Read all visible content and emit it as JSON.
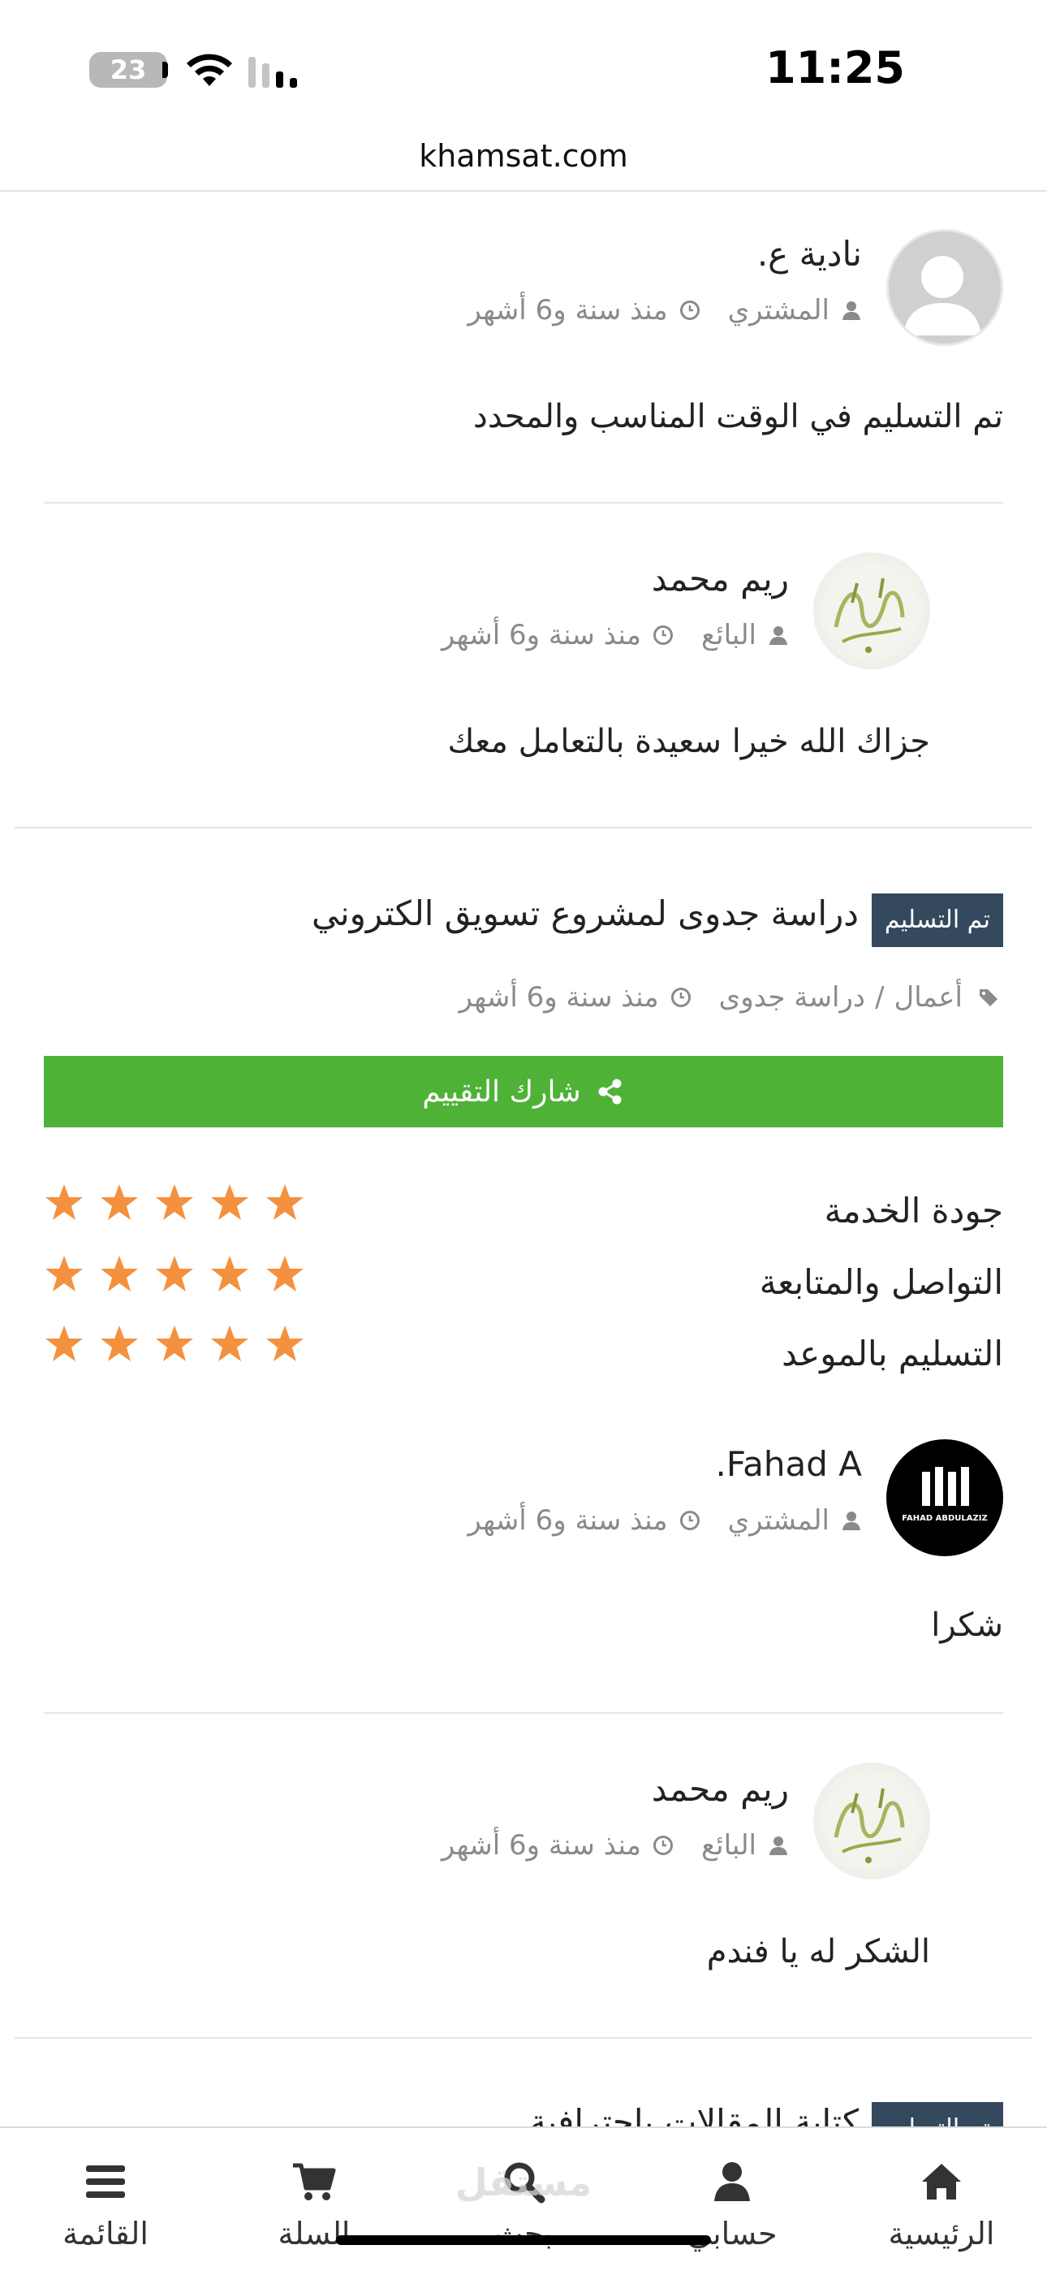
{
  "status_bar": {
    "time": "11:25",
    "battery_level": "23"
  },
  "browser": {
    "url": "khamsat.com"
  },
  "reviews_top": [
    {
      "name": "نادية ع.",
      "role": "المشتري",
      "time": "منذ سنة و6 أشهر",
      "text": "تم التسليم في الوقت المناسب والمحدد",
      "avatar": "default-user-icon"
    },
    {
      "name": "ريم محمد",
      "role": "البائع",
      "time": "منذ سنة و6 أشهر",
      "text": "جزاك الله خيرا سعيدة بالتعامل معك",
      "avatar": "calligraphy-avatar"
    }
  ],
  "service": {
    "badge": "تم التسليم",
    "title": "دراسة جدوى لمشروع تسويق الكتروني",
    "category_prefix": "أعمال",
    "category_separator": "/",
    "category": "دراسة جدوى",
    "time": "منذ سنة و6 أشهر",
    "share_label": "شارك التقييم",
    "ratings": [
      {
        "label": "جودة الخدمة",
        "stars": 5
      },
      {
        "label": "التواصل والمتابعة",
        "stars": 5
      },
      {
        "label": "التسليم بالموعد",
        "stars": 5
      }
    ],
    "star_color": "#f4913e",
    "share_color": "#4eb237",
    "badge_color": "#34495e"
  },
  "reviews_bottom": [
    {
      "name": "Fahad A.",
      "role": "المشتري",
      "time": "منذ سنة و6 أشهر",
      "text": "شكرا",
      "avatar": "fahad-abdulaziz-logo"
    },
    {
      "name": "ريم محمد",
      "role": "البائع",
      "time": "منذ سنة و6 أشهر",
      "text": "الشكر له يا فندم",
      "avatar": "calligraphy-avatar"
    }
  ],
  "next_service": {
    "badge": "تم التسليم",
    "title": "كتابة المقالات باحترافية"
  },
  "logo_text": {
    "fahad": "FAHAD ABDULAZIZ",
    "calligraphy": "اللهم صل على سيدنا محمد",
    "watermark": "مستقل"
  },
  "bottom_nav": [
    {
      "label": "الرئيسية",
      "icon": "home-icon"
    },
    {
      "label": "حسابي",
      "icon": "user-icon"
    },
    {
      "label": "بحث",
      "icon": "search-icon"
    },
    {
      "label": "السلة",
      "icon": "cart-icon"
    },
    {
      "label": "القائمة",
      "icon": "menu-icon"
    }
  ]
}
